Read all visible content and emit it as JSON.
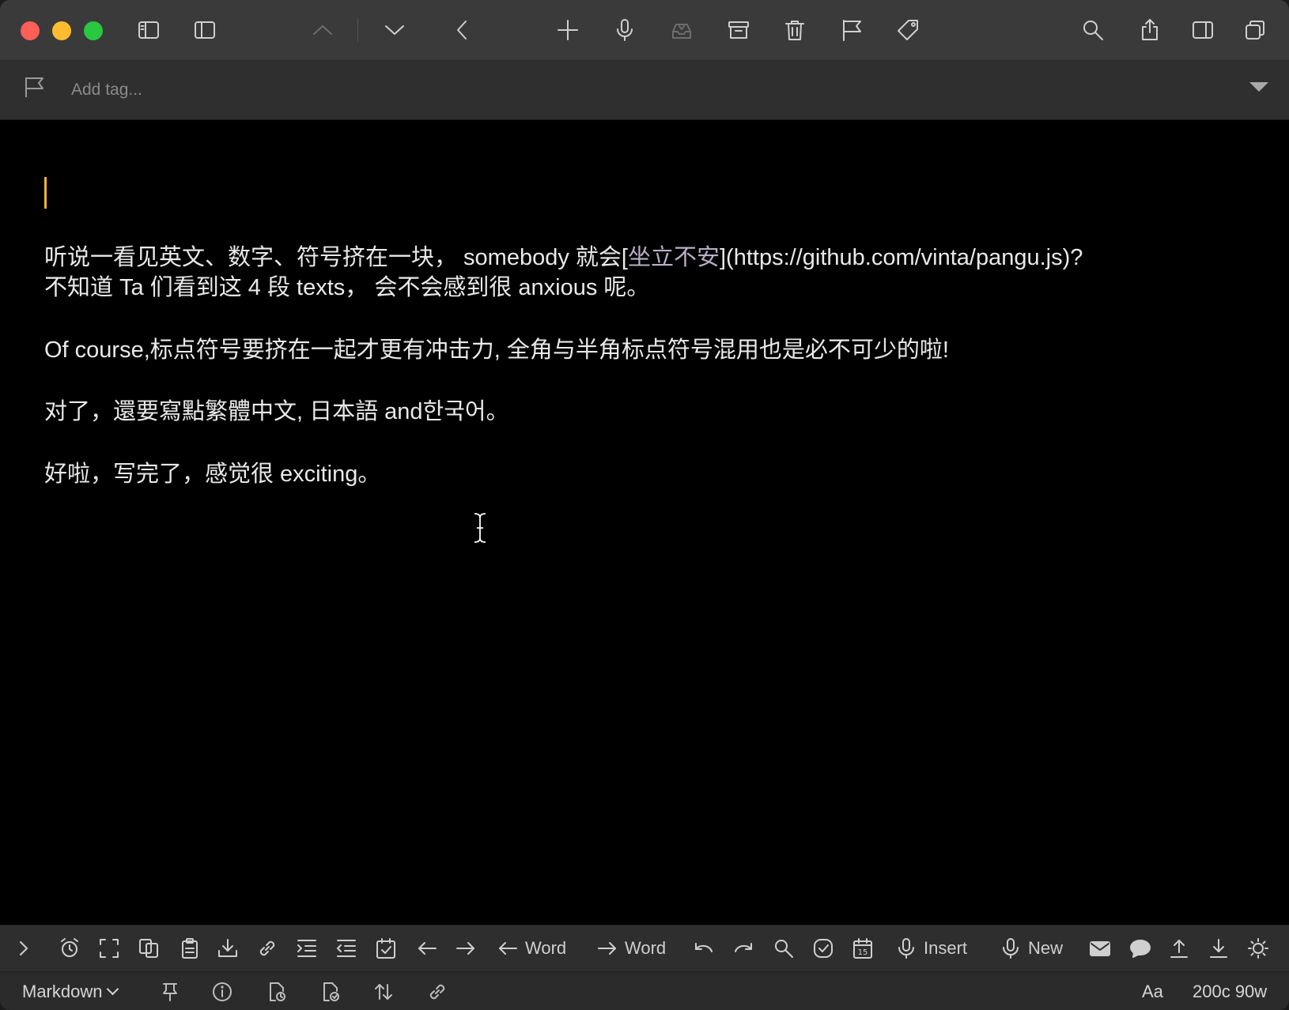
{
  "tags": {
    "placeholder": "Add tag..."
  },
  "editor": {
    "line1a": "听说一看见英文、数字、符号挤在一块， somebody 就会[",
    "line1_link": "坐立不安",
    "line1b": "](https://github.com/vinta/pangu.js)?",
    "line2": "不知道 Ta 们看到这 4 段 texts， 会不会感到很 anxious 呢。",
    "line3": "Of course,标点符号要挤在一起才更有冲击力, 全角与半角标点符号混用也是必不可少的啦!",
    "line4": "对了，還要寫點繁體中文, 日本語 and한국어。",
    "line5": "好啦，写完了，感觉很 exciting。"
  },
  "bottombar": {
    "word_left": "Word",
    "word_right": "Word",
    "insert": "Insert",
    "new": "New",
    "calendar_day": "15"
  },
  "statusbar": {
    "mode": "Markdown",
    "font_label": "Aa",
    "counts": "200c 90w"
  },
  "colors": {
    "caret": "#f0b429",
    "link": "#b9aec6",
    "close": "#fe5f57",
    "minimize": "#febc2e",
    "zoom": "#28c840"
  }
}
